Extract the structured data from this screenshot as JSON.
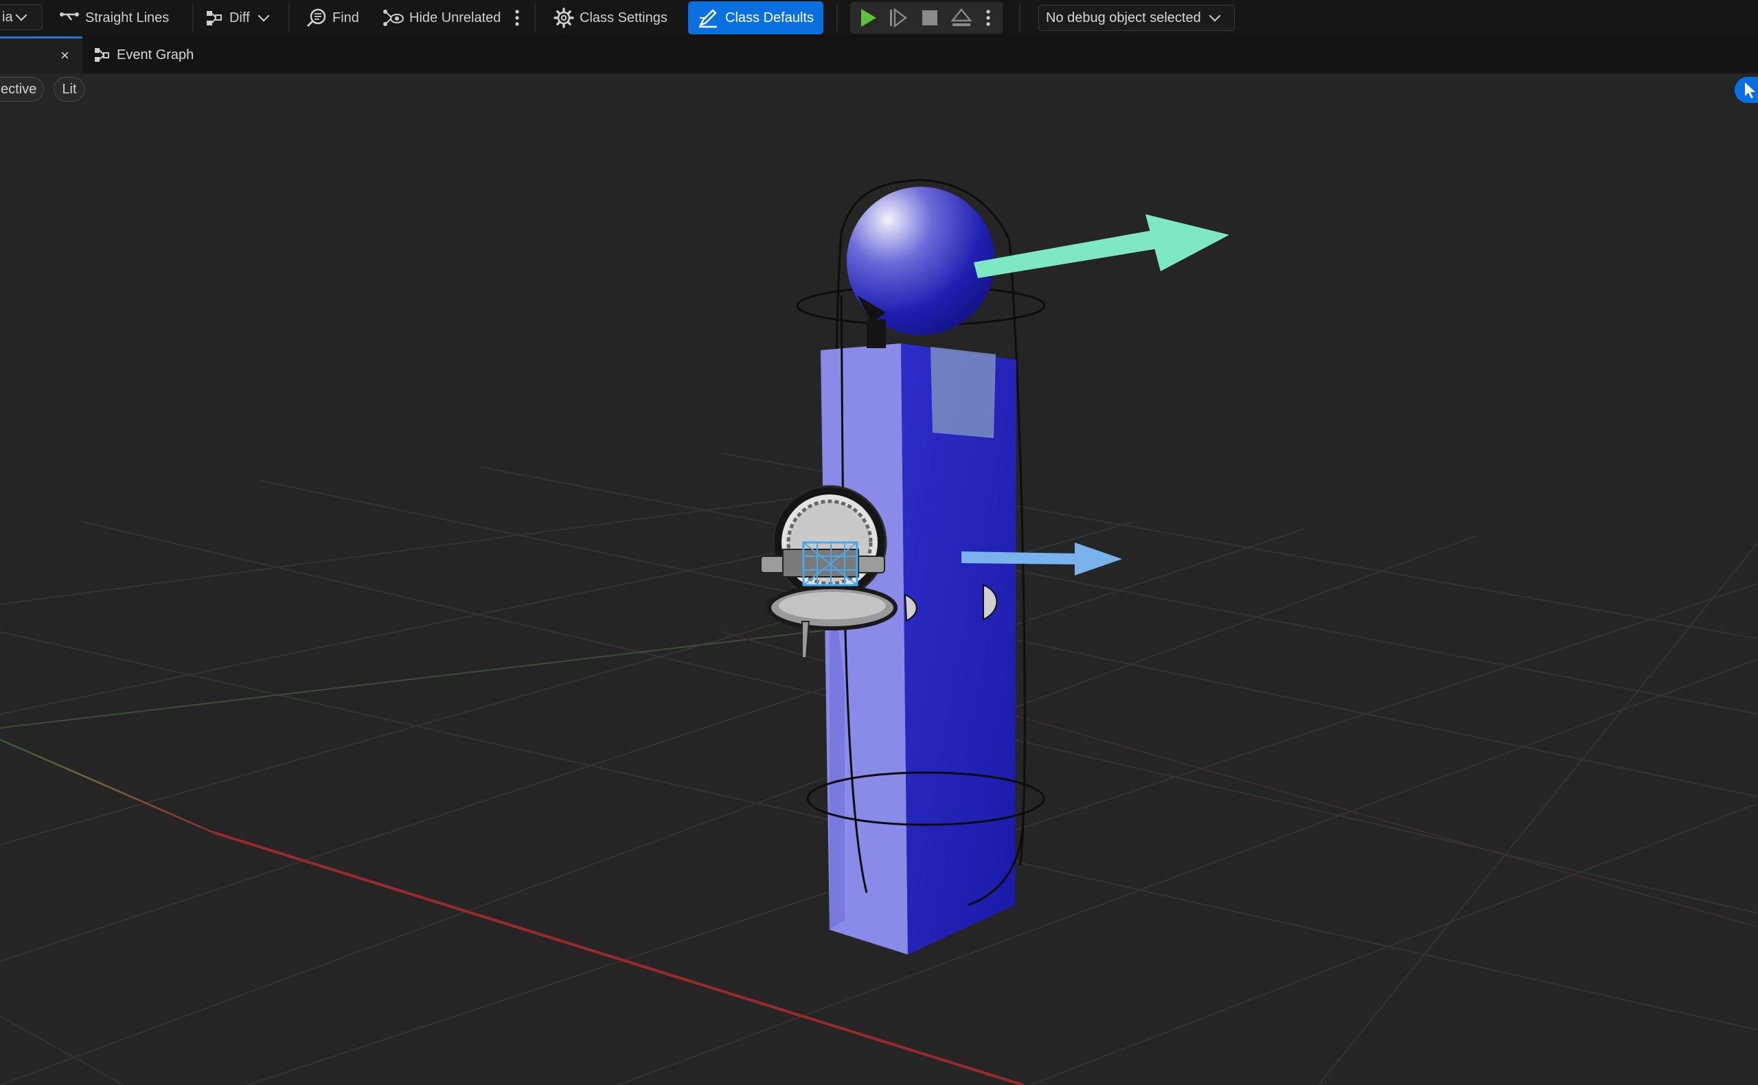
{
  "toolbar": {
    "asset_combo_fragment": "ia",
    "straight_lines": "Straight Lines",
    "diff": "Diff",
    "find": "Find",
    "hide_unrelated": "Hide Unrelated",
    "class_settings": "Class Settings",
    "class_defaults": "Class Defaults",
    "debug_object": "No debug object selected"
  },
  "tabs": {
    "active_close": "×",
    "event_graph": "Event Graph"
  },
  "viewport": {
    "perspective_fragment": "ective",
    "lit": "Lit"
  },
  "colors": {
    "accent": "#0a70e0",
    "play_green": "#5cc33a",
    "box_blue": "#2a2ac0",
    "box_light": "#8686e6",
    "arrow_cyan": "#7ee8c2",
    "arrow_blue": "#7ab2ee"
  },
  "icons": [
    "chevron-down-icon",
    "straight-lines-icon",
    "diff-icon",
    "find-icon",
    "hide-unrelated-icon",
    "more-icon",
    "gear-icon",
    "class-defaults-icon",
    "play-icon",
    "step-icon",
    "stop-icon",
    "eject-icon",
    "event-graph-icon",
    "select-mode-icon"
  ]
}
